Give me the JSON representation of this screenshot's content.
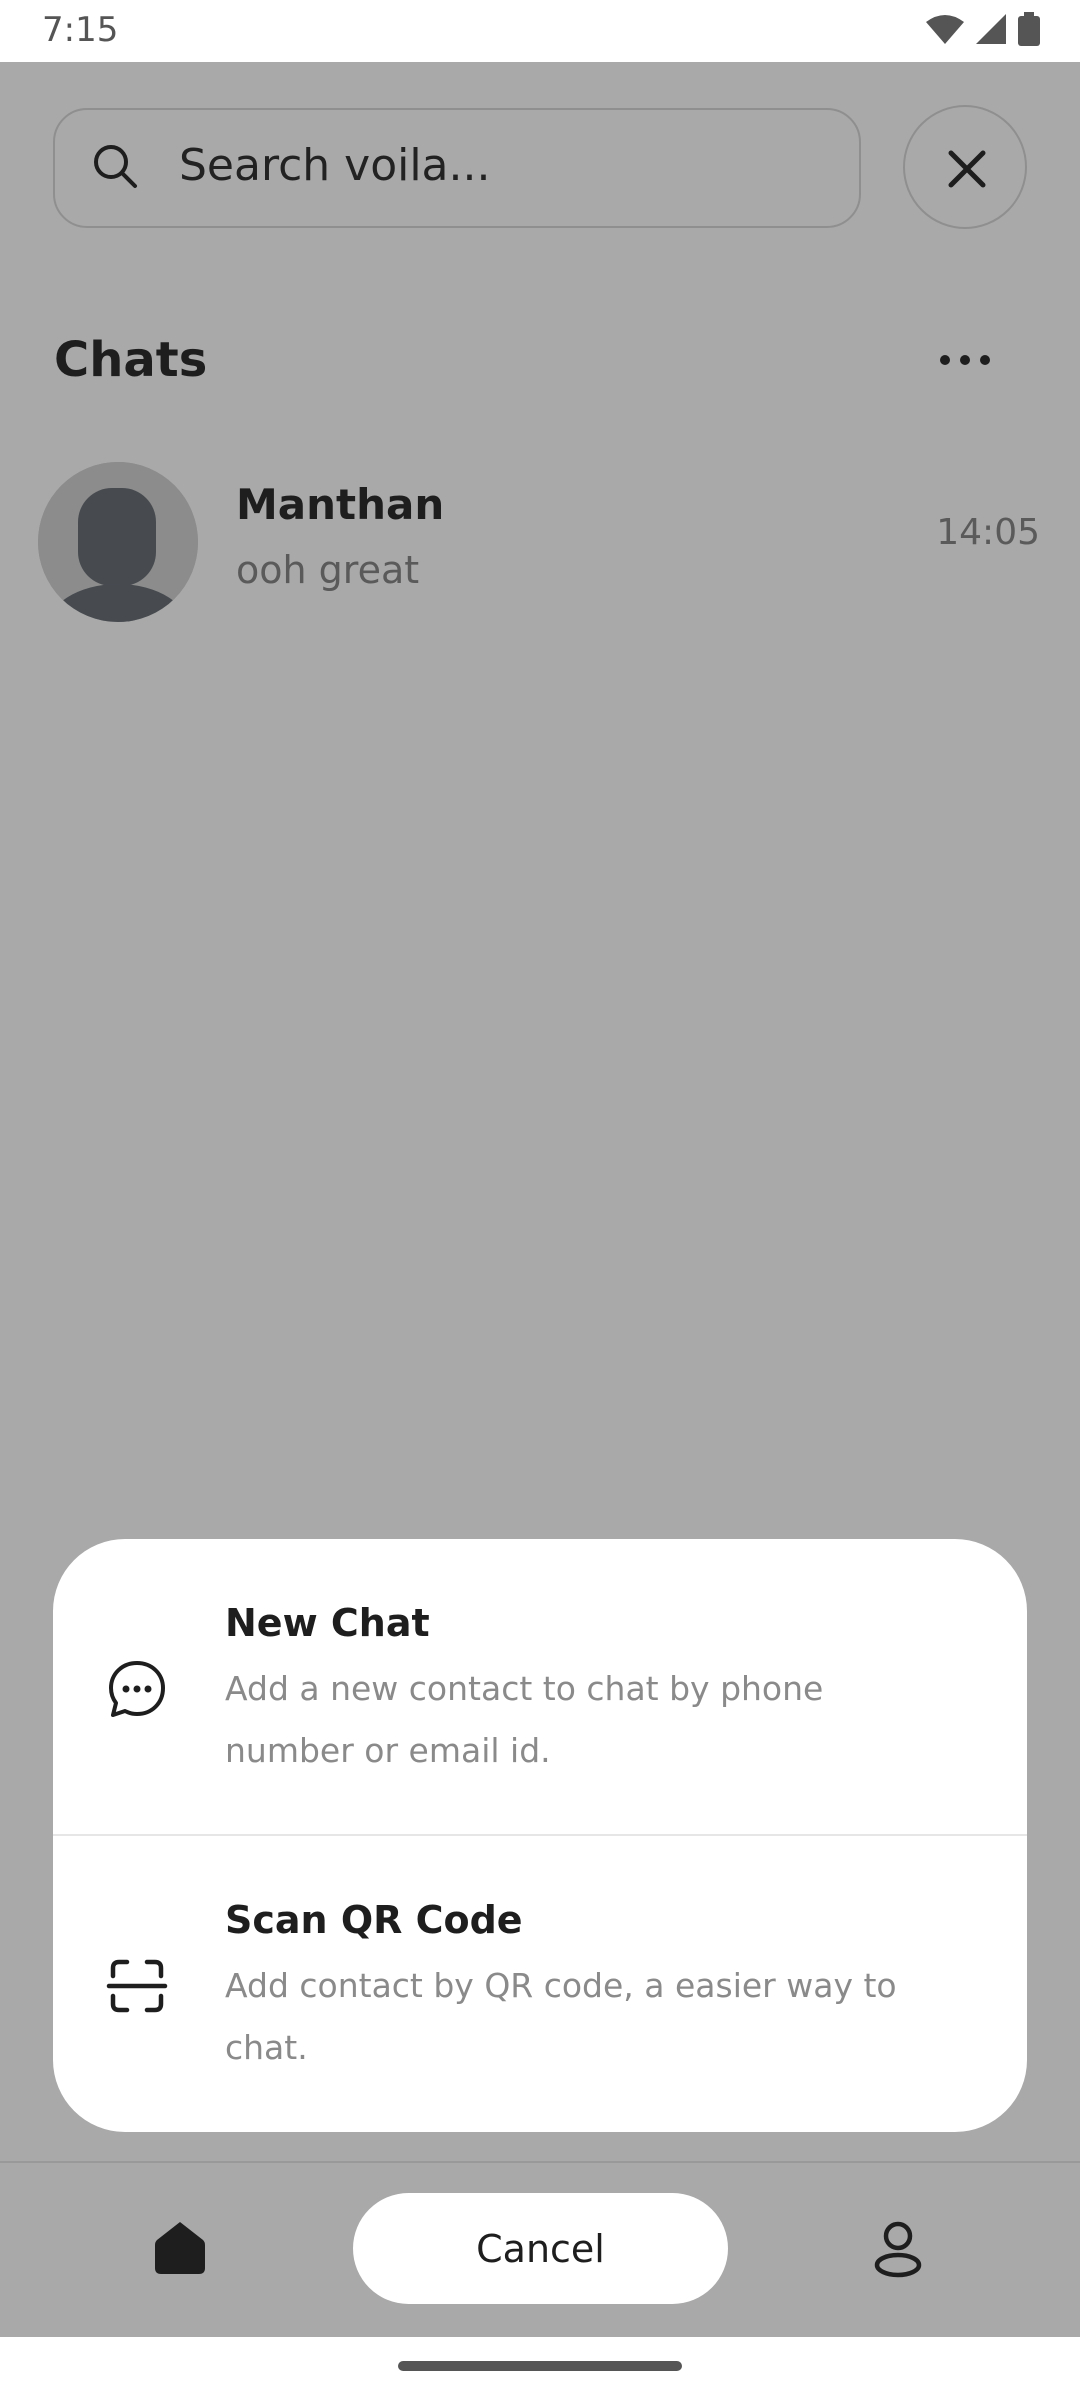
{
  "status_bar": {
    "time": "7:15"
  },
  "search": {
    "placeholder": "Search voila..."
  },
  "chats": {
    "title": "Chats",
    "items": [
      {
        "name": "Manthan",
        "last_message": "ooh great",
        "time": "14:05"
      }
    ]
  },
  "sheet": {
    "options": [
      {
        "title": "New Chat",
        "description": "Add a new contact to chat by phone number or email id.",
        "icon": "chat-bubble-dots-icon"
      },
      {
        "title": "Scan QR Code",
        "description": "Add contact by QR code, a easier way to chat.",
        "icon": "scan-qr-icon"
      }
    ]
  },
  "bottom_nav": {
    "cancel_label": "Cancel",
    "home_icon": "home-icon",
    "profile_icon": "profile-icon"
  },
  "colors": {
    "overlay": "#a9a9a9",
    "sheet": "#ffffff",
    "text_primary": "#1e1e1e",
    "text_secondary": "#8a8a8a"
  }
}
